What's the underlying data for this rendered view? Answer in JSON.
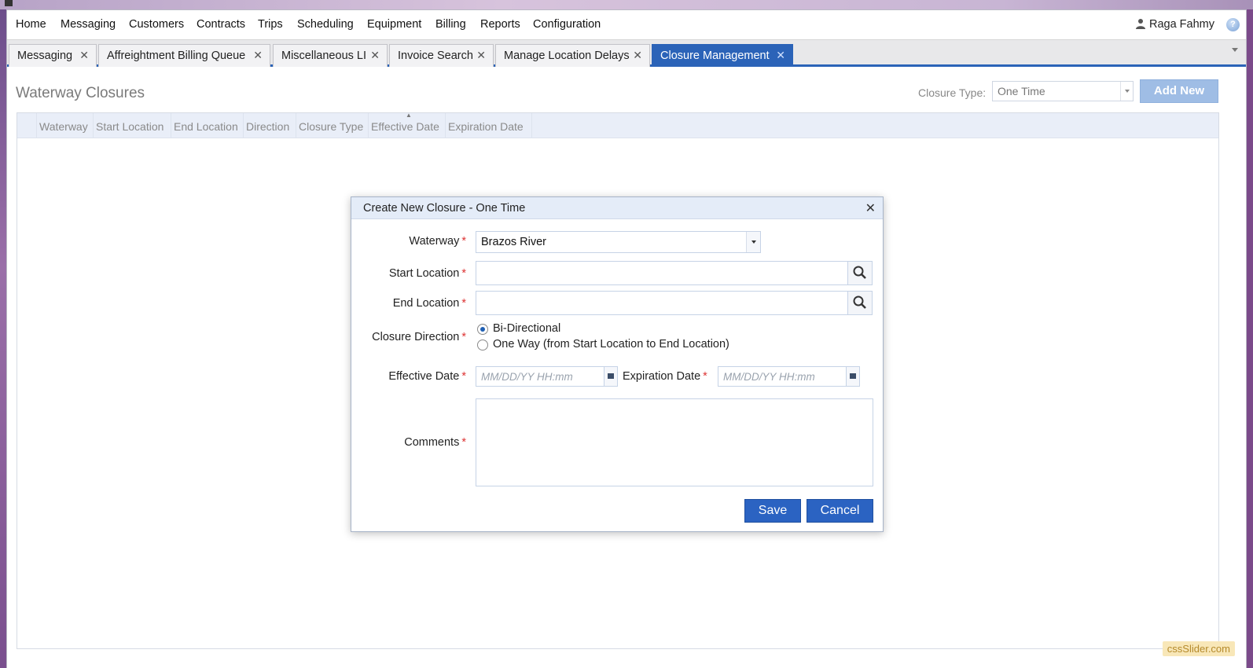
{
  "menu": {
    "items": [
      "Home",
      "Messaging",
      "Customers",
      "Contracts",
      "Trips",
      "Scheduling",
      "Equipment",
      "Billing",
      "Reports",
      "Configuration"
    ],
    "user_name": "Raga Fahmy"
  },
  "tabs": [
    {
      "label": "Messaging"
    },
    {
      "label": "Affreightment Billing Queue"
    },
    {
      "label": "Miscellaneous LI"
    },
    {
      "label": "Invoice Search"
    },
    {
      "label": "Manage Location Delays"
    },
    {
      "label": "Closure Management",
      "active": true
    }
  ],
  "page": {
    "title": "Waterway Closures",
    "closure_type_label": "Closure Type:",
    "closure_type_value": "One Time",
    "add_new_label": "Add New"
  },
  "grid": {
    "columns": [
      "Waterway",
      "Start Location",
      "End Location",
      "Direction",
      "Closure Type",
      "Effective Date",
      "Expiration Date"
    ]
  },
  "dialog": {
    "title": "Create New Closure - One Time",
    "waterway_label": "Waterway",
    "waterway_value": "Brazos River",
    "start_location_label": "Start Location",
    "end_location_label": "End Location",
    "closure_direction_label": "Closure Direction",
    "direction_options": [
      "Bi-Directional",
      "One Way (from Start Location to End Location)"
    ],
    "selected_direction": "Bi-Directional",
    "effective_date_label": "Effective Date",
    "expiration_date_label": "Expiration Date",
    "date_placeholder": "MM/DD/YY HH:mm",
    "comments_label": "Comments",
    "save_label": "Save",
    "cancel_label": "Cancel",
    "required_mark": "*"
  },
  "watermark": "cssSlider.com",
  "colors": {
    "accent": "#2b63b8",
    "button_primary": "#2b63c2",
    "required": "#dd3333"
  }
}
